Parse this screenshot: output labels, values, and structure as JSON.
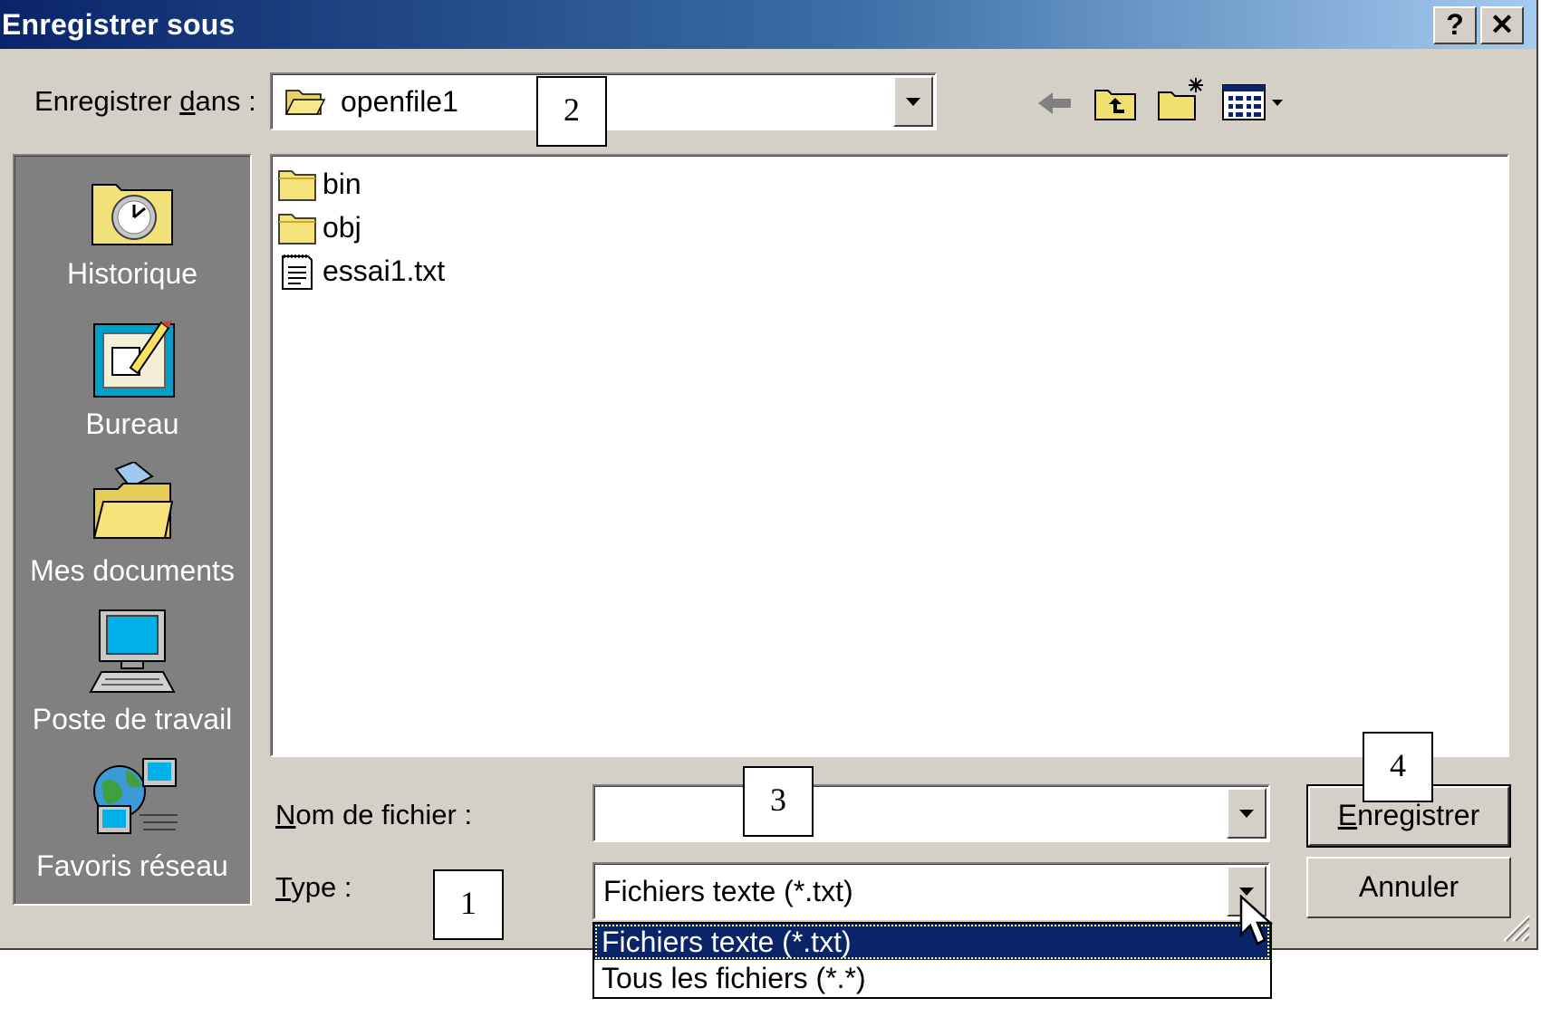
{
  "window": {
    "title": "Enregistrer sous",
    "help_glyph": "?",
    "close_glyph": "✕",
    "titlebar_gradient": [
      "#0a246a",
      "#a6caf0"
    ],
    "face_color": "#d4d0c8"
  },
  "location": {
    "label_before": "Enregistrer ",
    "label_key": "d",
    "label_after": "ans :",
    "current_folder": "openfile1",
    "folder_icon": "open-folder-icon"
  },
  "toolbar": {
    "icons": [
      "back-arrow-icon",
      "up-one-level-icon",
      "new-folder-icon",
      "view-menu-icon"
    ]
  },
  "places": [
    {
      "label": "Historique",
      "icon": "history-icon"
    },
    {
      "label": "Bureau",
      "icon": "desktop-icon"
    },
    {
      "label": "Mes documents",
      "icon": "my-documents-icon"
    },
    {
      "label": "Poste de travail",
      "icon": "my-computer-icon"
    },
    {
      "label": "Favoris réseau",
      "icon": "network-places-icon"
    }
  ],
  "files": [
    {
      "name": "bin",
      "type": "folder"
    },
    {
      "name": "obj",
      "type": "folder"
    },
    {
      "name": "essai1.txt",
      "type": "text-file"
    }
  ],
  "filename": {
    "label_key": "N",
    "label_rest": "om de fichier :",
    "value": ""
  },
  "filetype": {
    "label_key": "T",
    "label_rest": "ype :",
    "value": "Fichiers texte (*.txt)",
    "options": [
      "Fichiers texte (*.txt)",
      "Tous les fichiers (*.*)"
    ],
    "selected_index": 0,
    "highlight_color": "#0a246a"
  },
  "buttons": {
    "save_key": "E",
    "save_rest": "nregistrer",
    "cancel": "Annuler"
  },
  "callouts": [
    "1",
    "2",
    "3",
    "4"
  ]
}
